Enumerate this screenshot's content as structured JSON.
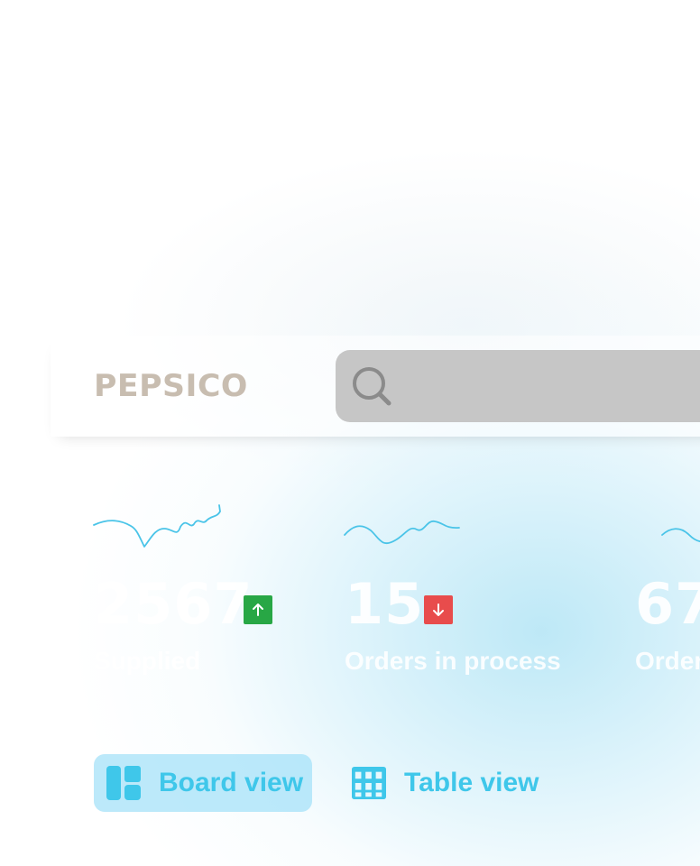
{
  "brand": {
    "name": "PEPSICO",
    "logo_color": "#c8bdb0"
  },
  "search": {
    "placeholder": "",
    "value": ""
  },
  "metrics": [
    {
      "value": "2567",
      "label": "Supplied",
      "trend": "up",
      "trend_icon": "arrow-up-icon",
      "sparkline": "supplied-sparkline-icon"
    },
    {
      "value": "15",
      "label": "Orders in process",
      "trend": "down",
      "trend_icon": "arrow-down-icon",
      "sparkline": "orders-in-process-sparkline-icon"
    },
    {
      "value": "67",
      "label": "Order",
      "trend": "",
      "trend_icon": "",
      "sparkline": "orders-sparkline-icon"
    }
  ],
  "views": {
    "board_label": "Board view",
    "table_label": "Table view",
    "selected": "Board view"
  },
  "colors": {
    "accent": "#3fc7ea",
    "trend_up": "#28a745",
    "trend_down": "#e84c4c",
    "search_background": "#c6c6c6",
    "metric_text": "#ffffff"
  }
}
